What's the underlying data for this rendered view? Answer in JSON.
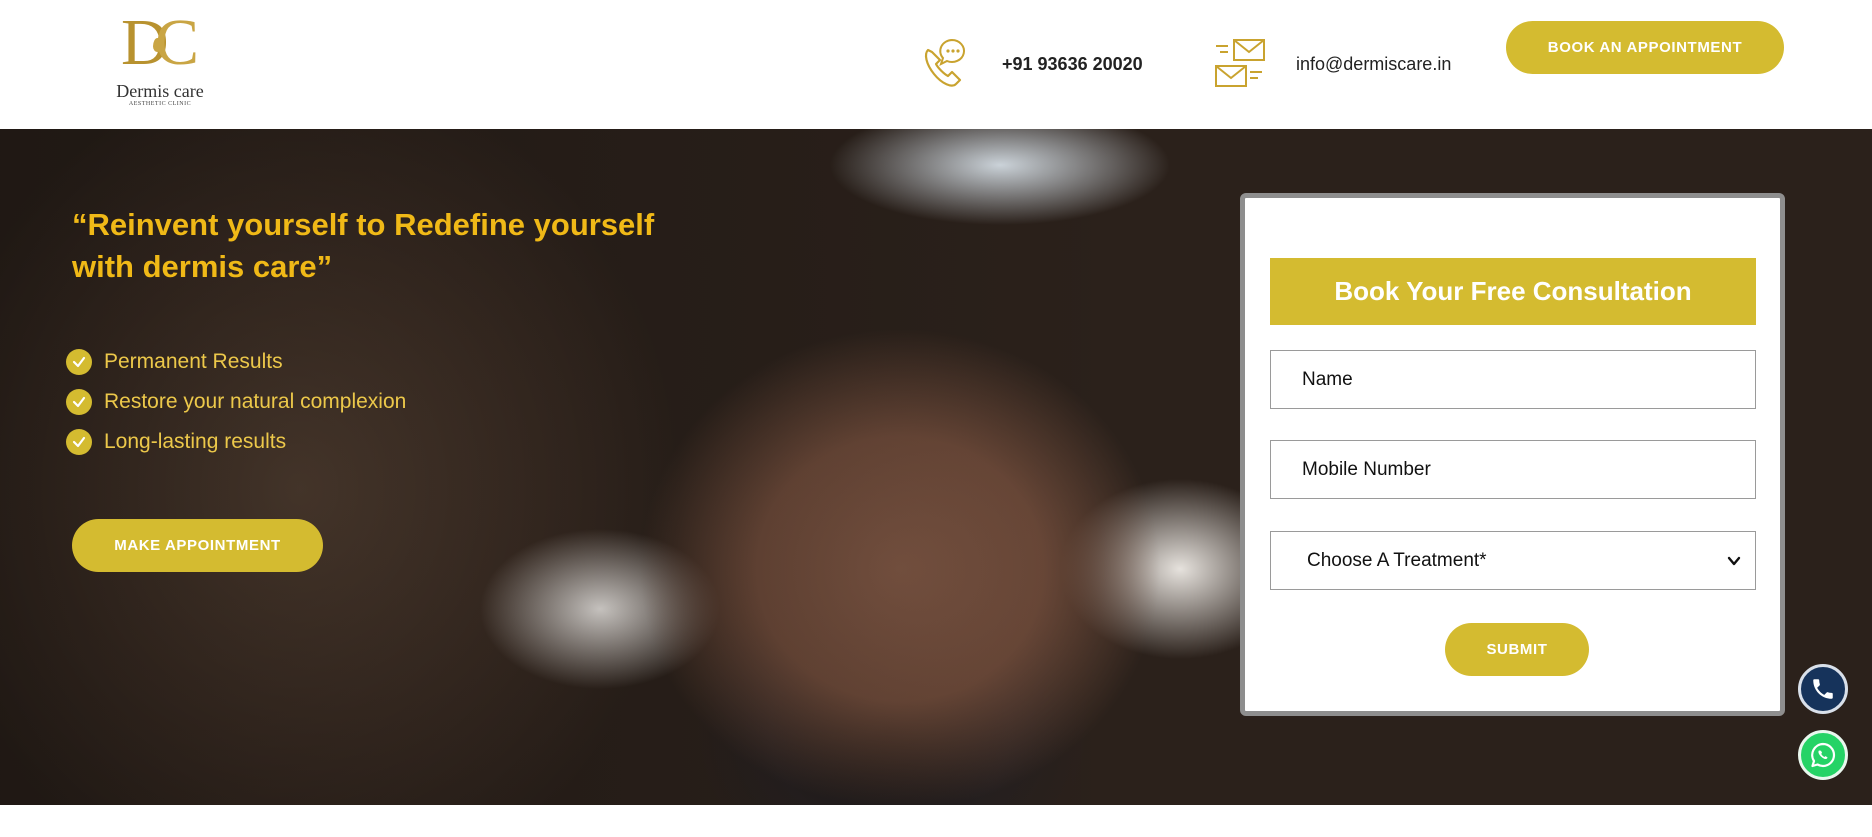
{
  "brand": {
    "monogram_left": "D",
    "monogram_right": "C",
    "name": "Dermis care",
    "tagline": "AESTHETIC CLINIC",
    "color": "#b8922f"
  },
  "header": {
    "phone": {
      "icon": "phone-chat-icon",
      "text": "+91 93636 20020"
    },
    "email": {
      "icon": "mail-icon",
      "text": "info@dermiscare.in"
    },
    "book_button": "BOOK AN APPOINTMENT"
  },
  "hero": {
    "title": "“Reinvent yourself to Redefine yourself with dermis care”",
    "features": [
      {
        "label": "Permanent Results",
        "icon": "check-circle-icon"
      },
      {
        "label": "Restore your natural complexion",
        "icon": "check-circle-icon"
      },
      {
        "label": "Long-lasting results",
        "icon": "check-circle-icon"
      }
    ],
    "cta_button": "MAKE APPOINTMENT"
  },
  "form": {
    "title": "Book Your Free Consultation",
    "name_placeholder": "Name",
    "mobile_placeholder": "Mobile Number",
    "treatment_selected": "Choose A Treatment*",
    "submit_button": "SUBMIT"
  },
  "floating": {
    "call_icon": "phone-icon",
    "whatsapp_icon": "whatsapp-icon"
  },
  "colors": {
    "accent": "#d4bb30",
    "hero_title": "#f0b917",
    "feature_text": "#ecc84a",
    "call_button": "#16335b",
    "whatsapp_button": "#25d366"
  }
}
